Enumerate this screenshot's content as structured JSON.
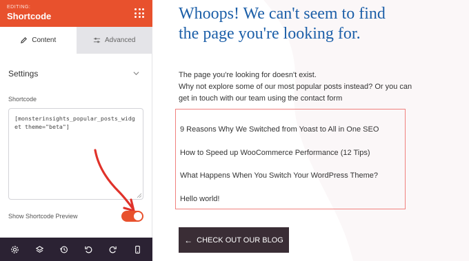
{
  "panel": {
    "editing_label": "EDITING:",
    "title": "Shortcode",
    "tabs": [
      {
        "label": "Content",
        "active": true
      },
      {
        "label": "Advanced",
        "active": false
      }
    ],
    "section_title": "Settings",
    "shortcode_label": "Shortcode",
    "shortcode_value": "[monsterinsights_popular_posts_widget theme=\"beta\"]",
    "toggle_label": "Show Shortcode Preview",
    "toggle_on": true,
    "accent_color": "#e8512d",
    "bottom_icons": [
      "gear-icon",
      "layers-icon",
      "history-icon",
      "undo-icon",
      "redo-icon",
      "mobile-icon"
    ]
  },
  "page": {
    "headline": "Whoops! We can't seem to find the page you're looking for.",
    "intro_line1": "The page you're looking for doesn't exist.",
    "intro_line2": "Why not explore some of our most popular posts instead? Or you can get in touch with our team using the contact form",
    "posts": [
      "9 Reasons Why We Switched from Yoast to All in One SEO",
      "How to Speed up WooCommerce Performance (12 Tips)",
      "What Happens When You Switch Your WordPress Theme?",
      "Hello world!"
    ],
    "button_label": "CHECK OUT OUR BLOG",
    "headline_color": "#1c5fa8",
    "box_border_color": "#f0807d",
    "button_color": "#3a2d35"
  }
}
